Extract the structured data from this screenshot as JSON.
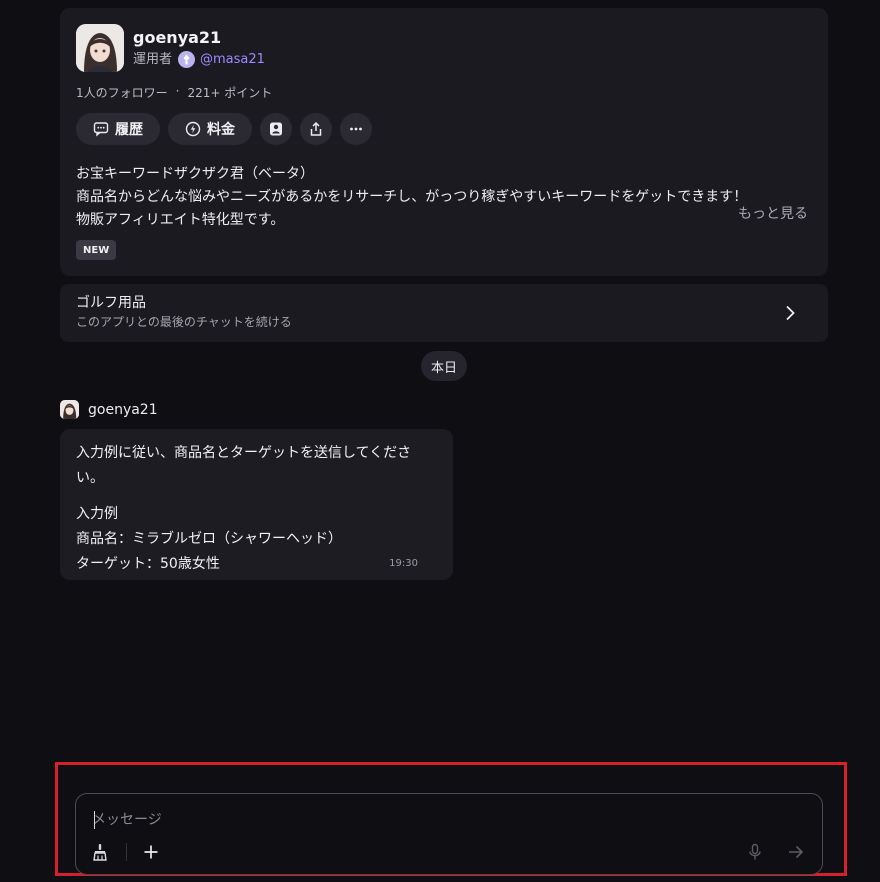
{
  "bot": {
    "name": "goenya21",
    "operator_label": "運用者",
    "operator_handle": "@masa21",
    "followers": "1人のフォロワー",
    "stat_sep": "·",
    "points": "221+ ポイント",
    "actions": {
      "history": "履歴",
      "price": "料金"
    },
    "description": [
      "お宝キーワードザクザク君（ベータ）",
      "商品名からどんな悩みやニーズがあるかをリサーチし、がっつり稼ぎやすいキーワードをゲットできます！",
      "物販アフィリエイト特化型です。"
    ],
    "more": "もっと見る",
    "tag": "NEW"
  },
  "last_chat": {
    "title": "ゴルフ用品",
    "subtitle": "このアプリとの最後のチャットを続ける"
  },
  "date_chip": "本日",
  "message": {
    "sender": "goenya21",
    "lines": [
      "入力例に従い、商品名とターゲットを送信してください。",
      "入力例",
      "商品名：ミラブルゼロ（シャワーヘッド）",
      "ターゲット：50歳女性"
    ],
    "time": "19:30"
  },
  "composer": {
    "placeholder": "メッセージ",
    "value": ""
  },
  "icons": {
    "history": "chat-history-icon",
    "price": "lightning-coin-icon",
    "add_contact": "person-add-icon",
    "share": "share-icon",
    "more": "ellipsis-icon",
    "chevron": "chevron-right-icon",
    "brush": "brush-icon",
    "plus": "plus-icon",
    "mic": "microphone-icon",
    "send": "arrow-right-icon"
  },
  "colors": {
    "background": "#0f0e13",
    "card": "#1b1a21",
    "accent": "#9b8cff",
    "highlight": "#d6202b"
  }
}
